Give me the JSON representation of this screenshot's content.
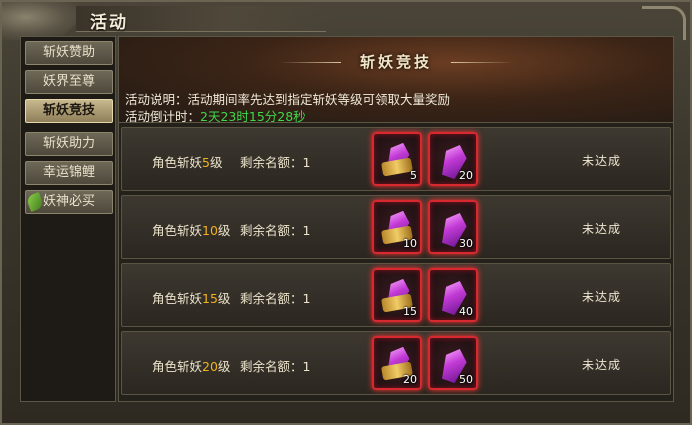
{
  "window": {
    "title": "活动"
  },
  "sidebar": {
    "items": [
      {
        "label": "斩妖赞助"
      },
      {
        "label": "妖界至尊"
      },
      {
        "label": "斩妖竞技",
        "active": true
      },
      {
        "label": "斩妖助力"
      },
      {
        "label": "幸运锦鲤"
      },
      {
        "label": "妖神必买",
        "icon": "leaf-icon"
      }
    ]
  },
  "header": {
    "title": "斩妖竞技",
    "description": "活动说明：活动期间率先达到指定斩妖等级可领取大量奖励",
    "countdown_label": "活动倒计时：",
    "countdown_value": "2天23时15分28秒"
  },
  "rows": [
    {
      "level_prefix": "角色斩妖",
      "level_num": "5",
      "level_suffix": "级",
      "quota": "剩余名额：1",
      "reward1_count": "5",
      "reward2_count": "20",
      "status": "未达成"
    },
    {
      "level_prefix": "角色斩妖",
      "level_num": "10",
      "level_suffix": "级",
      "quota": "剩余名额：1",
      "reward1_count": "10",
      "reward2_count": "30",
      "status": "未达成"
    },
    {
      "level_prefix": "角色斩妖",
      "level_num": "15",
      "level_suffix": "级",
      "quota": "剩余名额：1",
      "reward1_count": "15",
      "reward2_count": "40",
      "status": "未达成"
    },
    {
      "level_prefix": "角色斩妖",
      "level_num": "20",
      "level_suffix": "级",
      "quota": "剩余名额：1",
      "reward1_count": "20",
      "reward2_count": "50",
      "status": "未达成"
    }
  ],
  "colors": {
    "accent_level": "#f2b21e",
    "countdown": "#3fd84a",
    "item_border": "#d62a30"
  }
}
